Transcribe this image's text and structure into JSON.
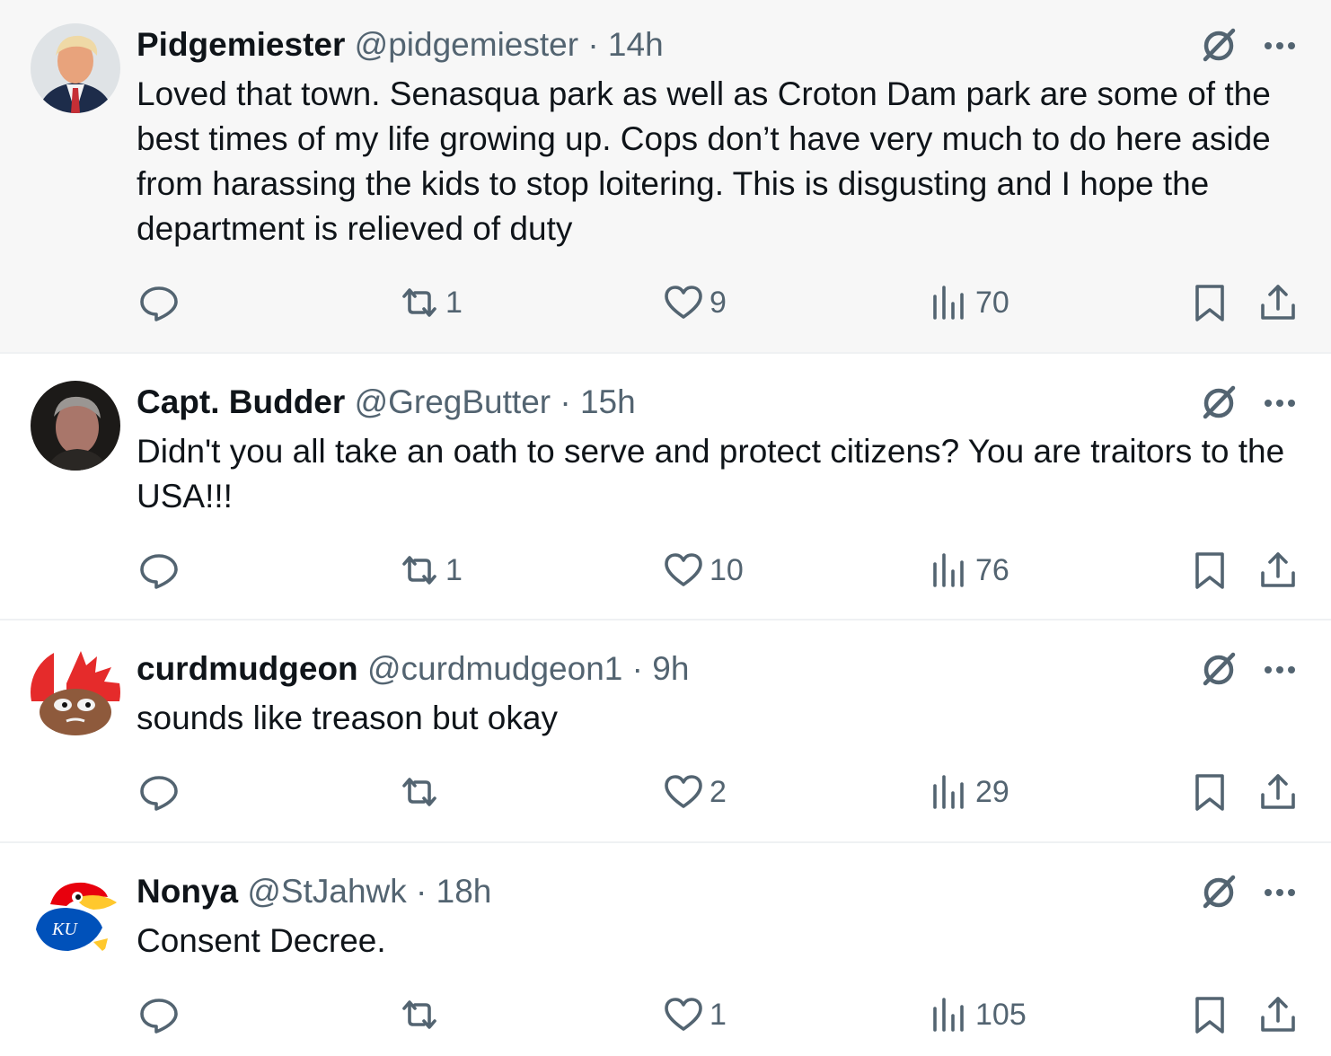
{
  "tweets": [
    {
      "name": "Pidgemiester",
      "handle": "@pidgemiester",
      "time": "· 14h",
      "text": "Loved that town. Senasqua park as well as Croton Dam park are some of the best times of my life growing up. Cops don’t have very much to do here aside from harassing the kids to stop loitering. This is disgusting and I hope the department is relieved of duty",
      "retweets": "1",
      "likes": "9",
      "views": "70"
    },
    {
      "name": "Capt. Budder",
      "handle": "@GregButter",
      "time": "· 15h",
      "text": "Didn't you all take an oath to serve and protect citizens?  You are traitors to the USA!!!",
      "retweets": "1",
      "likes": "10",
      "views": "76"
    },
    {
      "name": "curdmudgeon",
      "handle": "@curdmudgeon1",
      "time": "· 9h",
      "text": "sounds like treason but okay",
      "retweets": "",
      "likes": "2",
      "views": "29"
    },
    {
      "name": "Nonya",
      "handle": "@StJahwk",
      "time": "· 18h",
      "text": "Consent Decree.",
      "retweets": "",
      "likes": "1",
      "views": "105"
    }
  ],
  "avatar_text": {
    "ku_logo": "KU"
  },
  "colors": {
    "text": "#0f1419",
    "secondary": "#536471",
    "highlight_bg": "#f7f7f7",
    "divider": "#eff1f3"
  },
  "icons": {
    "grok": "grok-icon",
    "more": "more-icon",
    "reply": "reply-icon",
    "retweet": "retweet-icon",
    "like": "like-icon",
    "views": "views-icon",
    "bookmark": "bookmark-icon",
    "share": "share-icon"
  }
}
